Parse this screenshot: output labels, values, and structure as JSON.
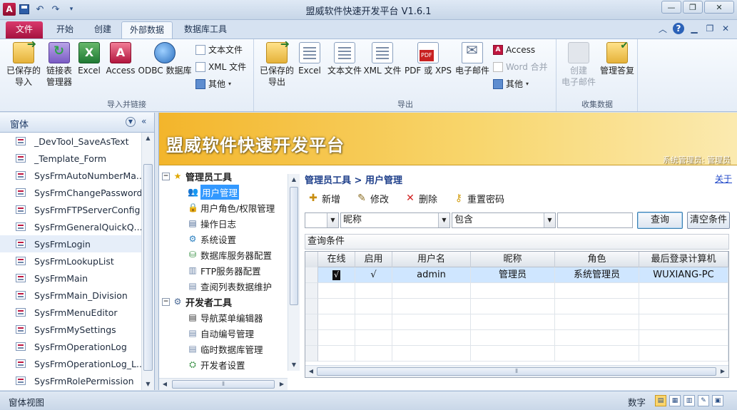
{
  "window": {
    "title": "盟威软件快速开发平台 V1.6.1",
    "logo_letter": "A",
    "minimize": "—",
    "restore": "❐",
    "close": "✕"
  },
  "ribbon": {
    "tabs": {
      "file": "文件",
      "start": "开始",
      "create": "创建",
      "external": "外部数据",
      "db_tools": "数据库工具"
    },
    "active_tab": "外部数据",
    "groups": {
      "import": {
        "label": "导入并链接",
        "saved_import": "已保存的\n导入",
        "link_manager": "链接表\n管理器",
        "excel": "Excel",
        "access": "Access",
        "odbc": "ODBC 数据库",
        "text_file": "文本文件",
        "xml_file": "XML 文件",
        "more": "其他"
      },
      "export": {
        "label": "导出",
        "saved_export": "已保存的\n导出",
        "excel": "Excel",
        "text_file": "文本文件",
        "xml_file": "XML 文件",
        "pdf_xps": "PDF 或 XPS",
        "email": "电子邮件",
        "access": "Access",
        "word_merge": "Word 合并",
        "more": "其他"
      },
      "collect": {
        "label": "收集数据",
        "create_email": "创建\n电子邮件",
        "manage_replies": "管理答复"
      }
    }
  },
  "nav": {
    "title": "窗体",
    "items": [
      "_DevTool_SaveAsText",
      "_Template_Form",
      "SysFrmAutoNumberMa...",
      "SysFrmChangePassword",
      "SysFrmFTPServerConfig",
      "SysFrmGeneralQuickQ...",
      "SysFrmLogin",
      "SysFrmLookupList",
      "SysFrmMain",
      "SysFrmMain_Division",
      "SysFrmMenuEditor",
      "SysFrmMySettings",
      "SysFrmOperationLog",
      "SysFrmOperationLog_L...",
      "SysFrmRolePermission"
    ],
    "selected_index": 6
  },
  "banner": {
    "title": "盟威软件快速开发平台",
    "user": "系统管理员: 管理员"
  },
  "tree": {
    "admin_tools": "管理员工具",
    "admin_children": [
      "用户管理",
      "用户角色/权限管理",
      "操作日志",
      "系统设置",
      "数据库服务器配置",
      "FTP服务器配置",
      "查阅列表数据维护"
    ],
    "dev_tools": "开发者工具",
    "dev_children": [
      "导航菜单编辑器",
      "自动编号管理",
      "临时数据库管理",
      "开发者设置"
    ]
  },
  "content": {
    "breadcrumb": "管理员工具 > 用户管理",
    "about": "关于",
    "toolbar": {
      "add": "新增",
      "edit": "修改",
      "delete": "删除",
      "reset_password": "重置密码"
    },
    "filter": {
      "logic_value": "",
      "field_value": "昵称",
      "operator_value": "包含",
      "keyword_value": "",
      "query_button": "查询",
      "clear_button": "清空条件"
    },
    "condition_label": "查询条件",
    "grid": {
      "columns": [
        "在线",
        "启用",
        "用户名",
        "昵称",
        "角色",
        "最后登录计算机"
      ],
      "rows": [
        {
          "online": "√",
          "enabled": "√",
          "username": "admin",
          "nickname": "管理员",
          "role": "系统管理员",
          "last_pc": "WUXIANG-PC"
        }
      ]
    }
  },
  "status": {
    "left": "窗体视图",
    "mode": "数字"
  },
  "colors": {
    "file_tab": "#c0163f",
    "banner": "#f3b52b",
    "selection": "#3399ff",
    "link": "#1f47c8"
  }
}
